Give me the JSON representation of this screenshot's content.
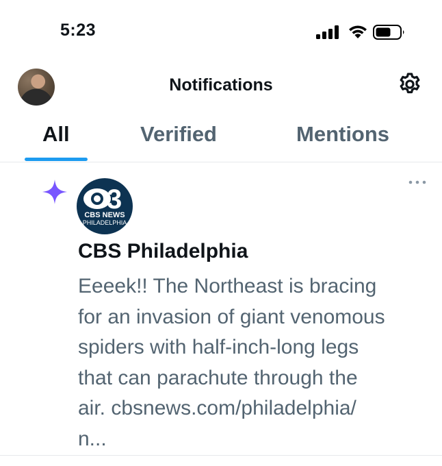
{
  "status_bar": {
    "time": "5:23",
    "icons": [
      "signal-icon",
      "wifi-icon",
      "battery-icon"
    ]
  },
  "header": {
    "title": "Notifications",
    "avatar": "avatar",
    "settings_icon": "gear-icon"
  },
  "tabs": [
    {
      "label": "All",
      "active": true
    },
    {
      "label": "Verified",
      "active": false
    },
    {
      "label": "Mentions",
      "active": false
    }
  ],
  "colors": {
    "accent": "#1d9bf0",
    "sparkle": "#7856ff",
    "secondary_text": "#536471",
    "logo_bg": "#0d3352"
  },
  "notification": {
    "icon": "sparkle-icon",
    "more_icon": "more-icon",
    "logo": {
      "mark": "3",
      "brand": "CBS NEWS",
      "city": "PHILADELPHIA"
    },
    "author": "CBS Philadelphia",
    "text_lines": [
      "Eeeek!!  The Northeast is bracing",
      "for an invasion of giant venomous",
      "spiders with half-inch-long legs",
      "that can parachute through the",
      "air. cbsnews.com/philadelphia/",
      "n..."
    ]
  }
}
